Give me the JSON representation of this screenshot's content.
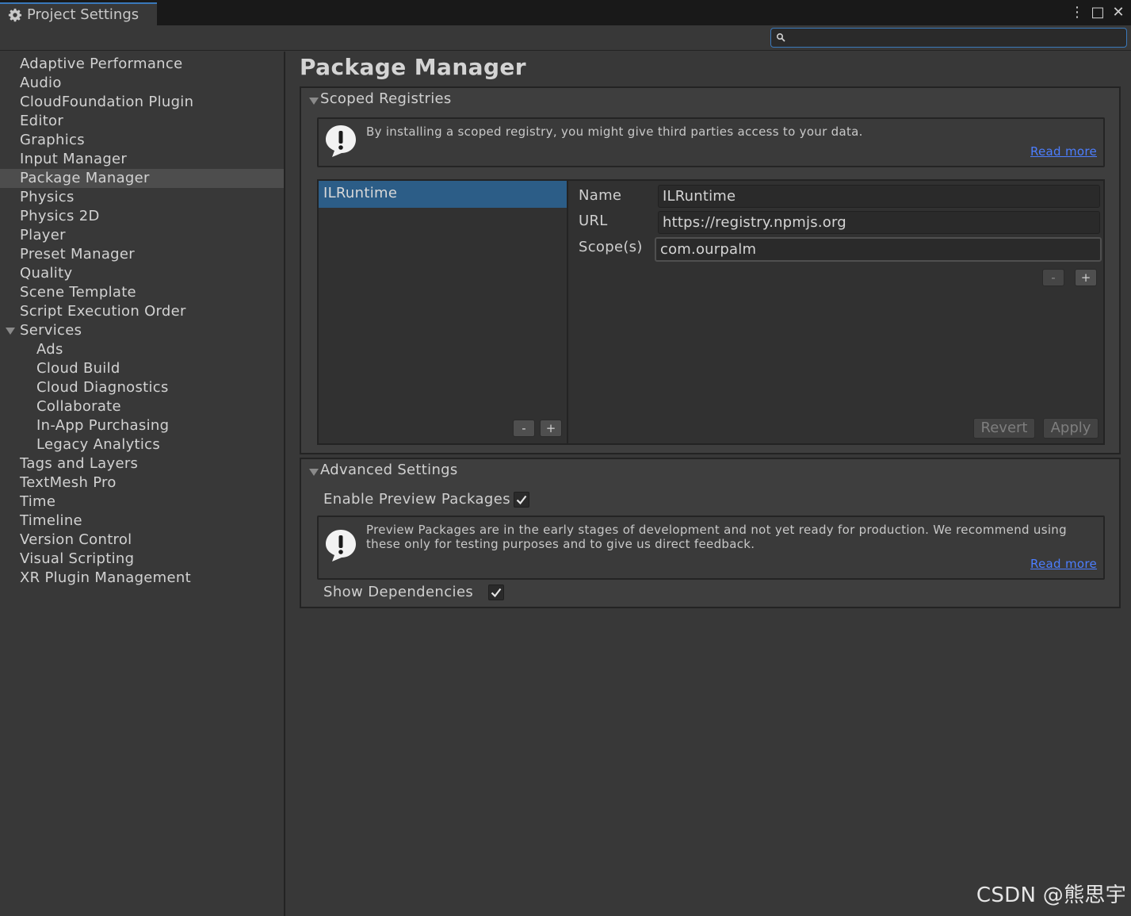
{
  "window": {
    "title": "Project Settings",
    "menu_icon": "⋮",
    "maximize_icon": "□",
    "close_icon": "✕"
  },
  "search": {
    "placeholder": "",
    "value": ""
  },
  "sidebar": {
    "items": [
      {
        "label": "Adaptive Performance"
      },
      {
        "label": "Audio"
      },
      {
        "label": "CloudFoundation Plugin"
      },
      {
        "label": "Editor"
      },
      {
        "label": "Graphics"
      },
      {
        "label": "Input Manager"
      },
      {
        "label": "Package Manager"
      },
      {
        "label": "Physics"
      },
      {
        "label": "Physics 2D"
      },
      {
        "label": "Player"
      },
      {
        "label": "Preset Manager"
      },
      {
        "label": "Quality"
      },
      {
        "label": "Scene Template"
      },
      {
        "label": "Script Execution Order"
      },
      {
        "label": "Services"
      },
      {
        "label": "Ads"
      },
      {
        "label": "Cloud Build"
      },
      {
        "label": "Cloud Diagnostics"
      },
      {
        "label": "Collaborate"
      },
      {
        "label": "In-App Purchasing"
      },
      {
        "label": "Legacy Analytics"
      },
      {
        "label": "Tags and Layers"
      },
      {
        "label": "TextMesh Pro"
      },
      {
        "label": "Time"
      },
      {
        "label": "Timeline"
      },
      {
        "label": "Version Control"
      },
      {
        "label": "Visual Scripting"
      },
      {
        "label": "XR Plugin Management"
      }
    ],
    "selected": "Package Manager"
  },
  "main": {
    "title": "Package Manager",
    "scoped": {
      "header": "Scoped Registries",
      "help_text": "By installing a scoped registry, you might give third parties access to your data.",
      "read_more": "Read more",
      "registries": [
        {
          "name": "ILRuntime"
        }
      ],
      "list_remove": "-",
      "list_add": "+",
      "labels": {
        "name": "Name",
        "url": "URL",
        "scopes": "Scope(s)"
      },
      "values": {
        "name": "ILRuntime",
        "url": "https://registry.npmjs.org",
        "scope": "com.ourpalm"
      },
      "scope_remove": "-",
      "scope_add": "+",
      "revert": "Revert",
      "apply": "Apply"
    },
    "advanced": {
      "header": "Advanced Settings",
      "enable_preview_label": "Enable Preview Packages",
      "enable_preview_checked": true,
      "help_text": "Preview Packages are in the early stages of development and not yet ready for production. We recommend using these only for testing purposes and to give us direct feedback.",
      "read_more": "Read more",
      "show_dependencies_label": "Show Dependencies",
      "show_dependencies_checked": true
    }
  },
  "watermark": "CSDN @熊思宇",
  "colors": {
    "selection": "#2c5d87",
    "link": "#4c7eff",
    "focus_accent": "#3a79bb"
  }
}
